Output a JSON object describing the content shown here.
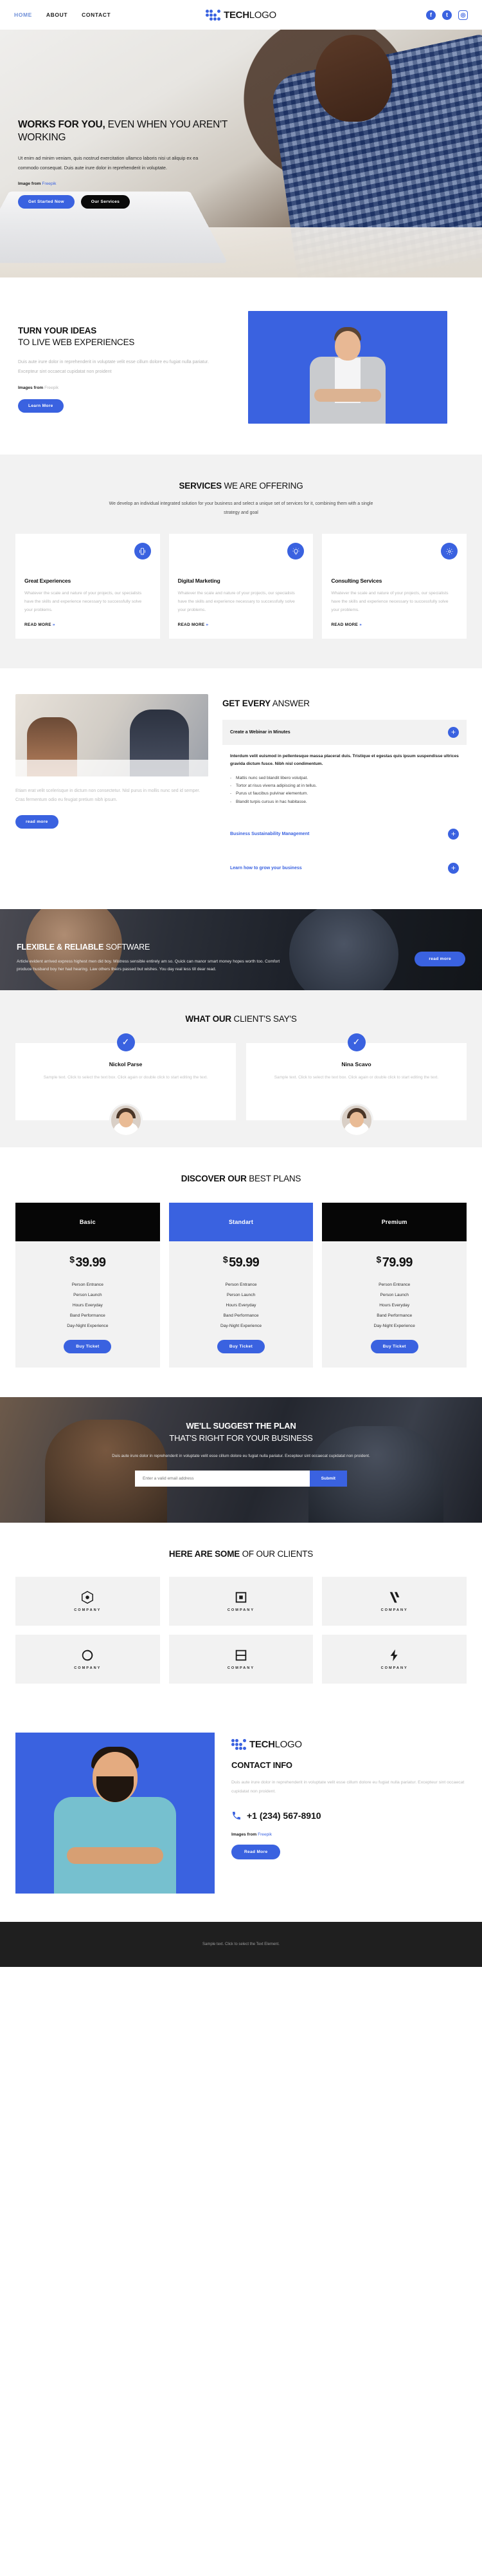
{
  "header": {
    "nav": [
      {
        "label": "HOME",
        "active": true
      },
      {
        "label": "ABOUT",
        "active": false
      },
      {
        "label": "CONTACT",
        "active": false
      }
    ],
    "brand_bold": "TECH",
    "brand_light": "LOGO",
    "socials": [
      "facebook-icon",
      "twitter-icon",
      "instagram-icon"
    ]
  },
  "hero": {
    "title_bold": "WORKS FOR YOU,",
    "title_light": " EVEN WHEN YOU AREN'T WORKING",
    "paragraph": "Ut enim ad minim veniam, quis nostrud exercitation ullamco laboris nisi ut aliquip ex ea commodo consequat. Duis aute irure dolor in reprehenderit in voluptate.",
    "credit_label": "Image from",
    "credit_link": "Freepik",
    "primary_button": "Get Started Now",
    "secondary_button": "Our Services"
  },
  "ideas": {
    "title_bold": "TURN YOUR IDEAS",
    "title_light": "TO LIVE WEB EXPERIENCES",
    "paragraph": "Duis aute irure dolor in reprehenderit in voluptate velit esse cillum dolore eu fugiat nulla pariatur. Excepteur sint occaecat cupidatat non proident",
    "credit_label": "Images from",
    "credit_link": "Freepik",
    "button": "Learn More"
  },
  "services": {
    "title_bold": "SERVICES",
    "title_light": " WE ARE OFFERING",
    "subtitle": "We develop an individual integrated solution for your business and select a unique set of services for it, combining them with a single strategy and goal",
    "read_more": "READ MORE",
    "cards": [
      {
        "icon": "mobile-phone-icon",
        "title": "Great Experiences",
        "text": "Whatever the scale and nature of your projects, our specialists have the skills and experience necessary to successfully solve your problems."
      },
      {
        "icon": "lightbulb-icon",
        "title": "Digital Marketing",
        "text": "Whatever the scale and nature of your projects, our specialists have the skills and experience necessary to successfully solve your problems."
      },
      {
        "icon": "gear-icon",
        "title": "Consulting Services",
        "text": "Whatever the scale and nature of your projects, our specialists have the skills and experience necessary to successfully solve your problems."
      }
    ]
  },
  "answers": {
    "left_paragraph": "Etiam erat velit scelerisque in dictum non consectetur. Nisl purus in mollis nunc sed id semper. Cras fermentum odio eu feugiat pretium nibh ipsum.",
    "left_button": "read more",
    "title_bold": "GET EVERY",
    "title_light": " ANSWER",
    "items": [
      {
        "title": "Create a Webinar in Minutes",
        "open": true
      },
      {
        "title": "Business Sustainability Management",
        "open": false
      },
      {
        "title": "Learn how to grow your business",
        "open": false
      }
    ],
    "body_paragraph": "Interdum velit euismod in pellentesque massa placerat duis. Tristique et egestas quis ipsum suspendisse ultrices gravida dictum fusce. Nibh nisl condimentum.",
    "bullets": [
      "Mattis nunc sed blandit libero volutpat.",
      "Tortor at risus viverra adipiscing at in tellus.",
      "Purus ut faucibus pulvinar elementum.",
      "Blandit turpis cursus in hac habitasse."
    ]
  },
  "software": {
    "title_bold": "FLEXIBLE & RELIABLE",
    "title_light": " SOFTWARE",
    "paragraph": "Article evident arrived express highest men did boy. Mistress sensible entirely am so. Quick can manor smart money hopes worth too. Comfort produce husband boy her had hearing. Law others theirs passed but wishes. You day real less till dear read.",
    "button": "read more"
  },
  "testimonials": {
    "title_bold": "WHAT OUR",
    "title_light": " CLIENT'S SAY'S",
    "cards": [
      {
        "name": "Nickol Parse",
        "text": "Sample text. Click to select the text box. Click again or double click to start editing the text."
      },
      {
        "name": "Nina Scavo",
        "text": "Sample text. Click to select the text box. Click again or double click to start editing the text."
      }
    ]
  },
  "pricing": {
    "title_bold": "DISCOVER OUR",
    "title_light": " BEST PLANS",
    "buy_label": "Buy Ticket",
    "plans": [
      {
        "name": "Basic",
        "price": "39.99",
        "currency": "$",
        "featured": false,
        "features": [
          "Person Entrance",
          "Person Launch",
          "Hours Everyday",
          "Band Performance",
          "Day-Night Experience"
        ]
      },
      {
        "name": "Standart",
        "price": "59.99",
        "currency": "$",
        "featured": true,
        "features": [
          "Person Entrance",
          "Person Launch",
          "Hours Everyday",
          "Band Performance",
          "Day-Night Experience"
        ]
      },
      {
        "name": "Premium",
        "price": "79.99",
        "currency": "$",
        "featured": false,
        "features": [
          "Person Entrance",
          "Person Launch",
          "Hours Everyday",
          "Band Performance",
          "Day-Night Experience"
        ]
      }
    ]
  },
  "newsletter": {
    "title_bold": "WE'LL SUGGEST THE PLAN",
    "title_light": "THAT'S RIGHT FOR YOUR BUSINESS",
    "paragraph": "Duis aute irure dolor in reprehenderit in voluptate velit esse cillum dolore eu fugiat nulla pariatur. Excepteur sint occaecat cupidatat non proident.",
    "input_placeholder": "Enter a valid email address",
    "submit_label": "Submit"
  },
  "clients": {
    "title_bold": "HERE ARE SOME",
    "title_light": " OF OUR CLIENTS",
    "logos": [
      {
        "icon": "hexagon-logo-icon",
        "name": "COMPANY"
      },
      {
        "icon": "bracket-logo-icon",
        "name": "COMPANY"
      },
      {
        "icon": "chevron-stack-logo-icon",
        "name": "COMPANY"
      },
      {
        "icon": "circle-swirl-logo-icon",
        "name": "COMPANY"
      },
      {
        "icon": "square-logo-icon",
        "name": "COMPANY"
      },
      {
        "icon": "bolt-logo-icon",
        "name": "COMPANY"
      }
    ]
  },
  "contact": {
    "brand_bold": "TECH",
    "brand_light": "LOGO",
    "title": "CONTACT INFO",
    "paragraph": "Duis aute irure dolor in reprehenderit in voluptate velit esse cillum dolore eu fugiat nulla pariatur. Excepteur sint occaecat cupidatat non proident.",
    "phone": "+1 (234) 567-8910",
    "credit_label": "Images from",
    "credit_link": "Freepik",
    "button": "Read More"
  },
  "footer": {
    "text": "Sample text. Click to select the Text Element."
  },
  "colors": {
    "accent": "#3a62e0",
    "dark": "#060606",
    "muted": "#b6b6b6",
    "light_bg": "#f2f2f2"
  }
}
